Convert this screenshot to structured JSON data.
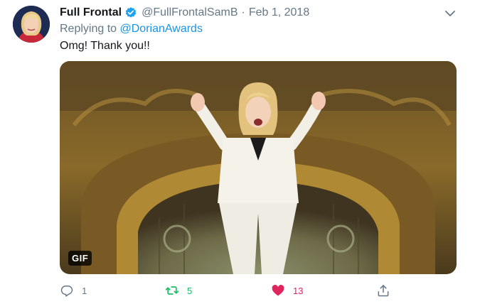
{
  "tweet": {
    "display_name": "Full Frontal",
    "verified": true,
    "handle": "@FullFrontalSamB",
    "separator": "·",
    "date": "Feb 1, 2018",
    "replying_prefix": "Replying to ",
    "replying_to": "@DorianAwards",
    "text": "Omg! Thank you!!",
    "media": {
      "type": "gif",
      "badge": "GIF"
    },
    "actions": {
      "reply_count": "1",
      "retweet_count": "5",
      "like_count": "13",
      "liked": true,
      "retweeted": true
    }
  },
  "icons": {
    "verified": "verified-badge-icon",
    "caret": "chevron-down-icon",
    "reply": "reply-icon",
    "retweet": "retweet-icon",
    "like": "heart-icon",
    "share": "share-icon"
  },
  "colors": {
    "link": "#1b95e0",
    "secondary_text": "#657786",
    "retweet": "#17bf63",
    "like": "#e0245e",
    "verified": "#1da1f2"
  }
}
